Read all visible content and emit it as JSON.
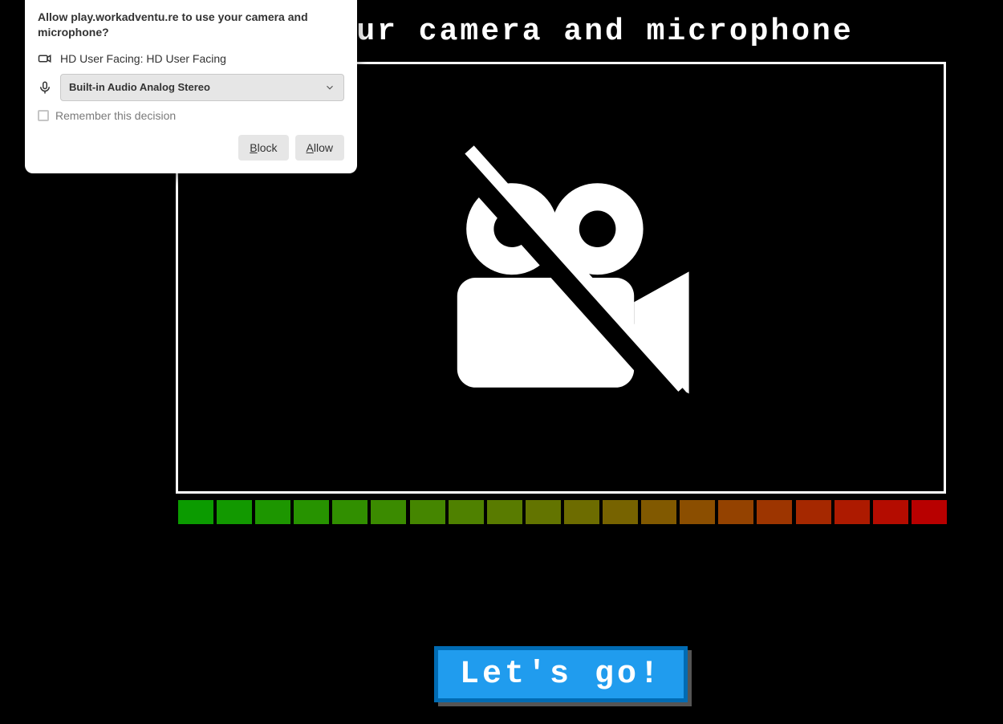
{
  "page": {
    "title": "Turn on your camera and microphone",
    "go_button": "Let's go!",
    "sound_meter_colors": [
      "#0b9b00",
      "#129900",
      "#1d9600",
      "#279300",
      "#318f00",
      "#3b8b00",
      "#458600",
      "#4f8100",
      "#597b00",
      "#637400",
      "#6d6c00",
      "#776300",
      "#815900",
      "#8b4e00",
      "#944200",
      "#9d3500",
      "#a52800",
      "#ad1a00",
      "#b40c00",
      "#b80000"
    ]
  },
  "permission_dialog": {
    "title": "Allow play.workadventu.re to use your camera and microphone?",
    "camera_label": "HD User Facing: HD User Facing",
    "audio_selected": "Built-in Audio Analog Stereo",
    "remember_label": "Remember this decision",
    "block_label": "Block",
    "allow_label": "Allow"
  }
}
